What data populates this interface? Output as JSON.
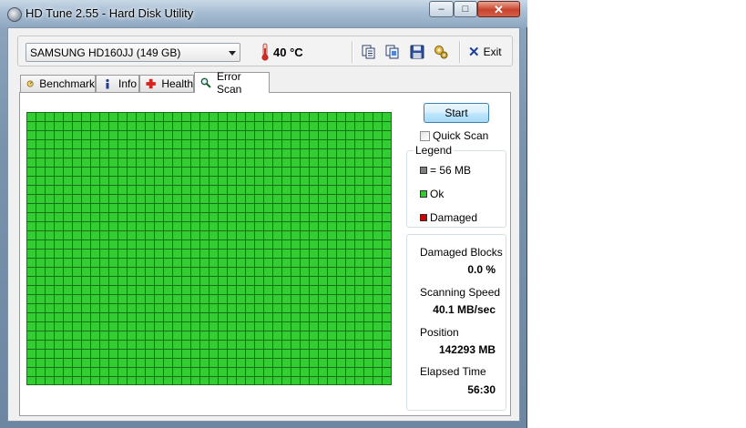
{
  "window": {
    "title": "HD Tune 2.55 - Hard Disk Utility",
    "minimize_glyph": "–",
    "maximize_glyph": "□",
    "close_glyph": "✕"
  },
  "toolbar": {
    "drive": "SAMSUNG HD160JJ (149 GB)",
    "temperature": "40 °C",
    "exit_label": "Exit",
    "icons": [
      "copy-text-icon",
      "copy-screenshot-icon",
      "save-icon",
      "options-icon"
    ]
  },
  "tabs": [
    {
      "label": "Benchmark",
      "icon": "benchmark-icon"
    },
    {
      "label": "Info",
      "icon": "info-icon"
    },
    {
      "label": "Health",
      "icon": "health-icon"
    },
    {
      "label": "Error Scan",
      "icon": "magnifier-icon",
      "active": true
    }
  ],
  "scan": {
    "start_label": "Start",
    "quick_scan_label": "Quick Scan",
    "quick_scan_checked": false,
    "block_status": "ok",
    "legend": {
      "title": "Legend",
      "block_size": "= 56 MB",
      "ok": "Ok",
      "damaged": "Damaged",
      "colors": {
        "block": "#808080",
        "ok": "#33cc33",
        "damaged": "#cc0000"
      }
    },
    "stats": {
      "damaged_blocks_label": "Damaged Blocks",
      "damaged_blocks_value": "0.0 %",
      "speed_label": "Scanning Speed",
      "speed_value": "40.1 MB/sec",
      "position_label": "Position",
      "position_value": "142293 MB",
      "elapsed_label": "Elapsed Time",
      "elapsed_value": "56:30"
    }
  }
}
